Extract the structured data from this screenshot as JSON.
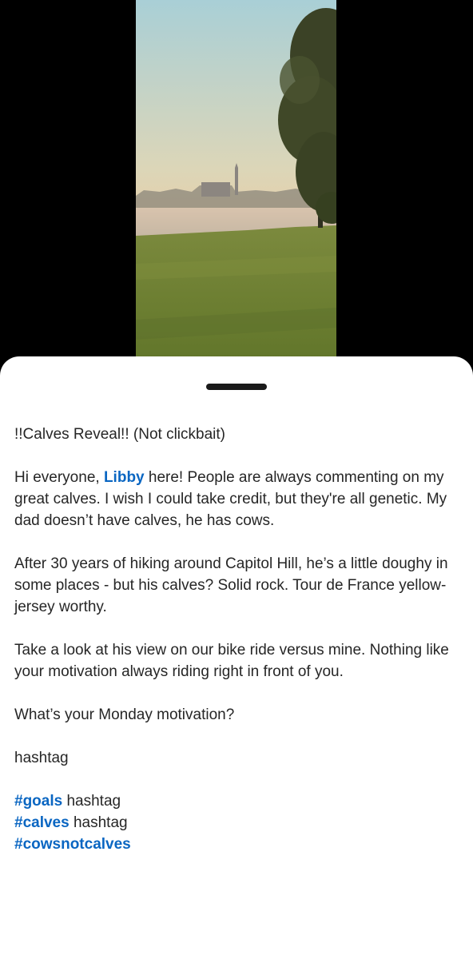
{
  "post": {
    "title": "!!Calves Reveal!! (Not clickbait)",
    "p1_before": "Hi everyone, ",
    "p1_mention": "Libby",
    "p1_after": " here! People are always commenting on my great calves. I wish I could take credit, but they're all genetic. My dad doesn’t have calves, he has cows.",
    "p2": "After 30 years of hiking around Capitol Hill, he’s a little doughy in some places - but his calves? Solid rock. Tour de France yellow-jersey worthy.",
    "p3": "Take a look at his view on our bike ride versus mine. Nothing like your motivation always riding right in front of you.",
    "p4": "What’s your Monday motivation?",
    "p5": "hashtag",
    "hashtags": [
      {
        "tag": "#goals",
        "suffix": " hashtag"
      },
      {
        "tag": "#calves",
        "suffix": " hashtag"
      },
      {
        "tag": "#cowsnotcalves",
        "suffix": ""
      }
    ]
  },
  "colors": {
    "link": "#0a66c2",
    "text": "#262626"
  }
}
